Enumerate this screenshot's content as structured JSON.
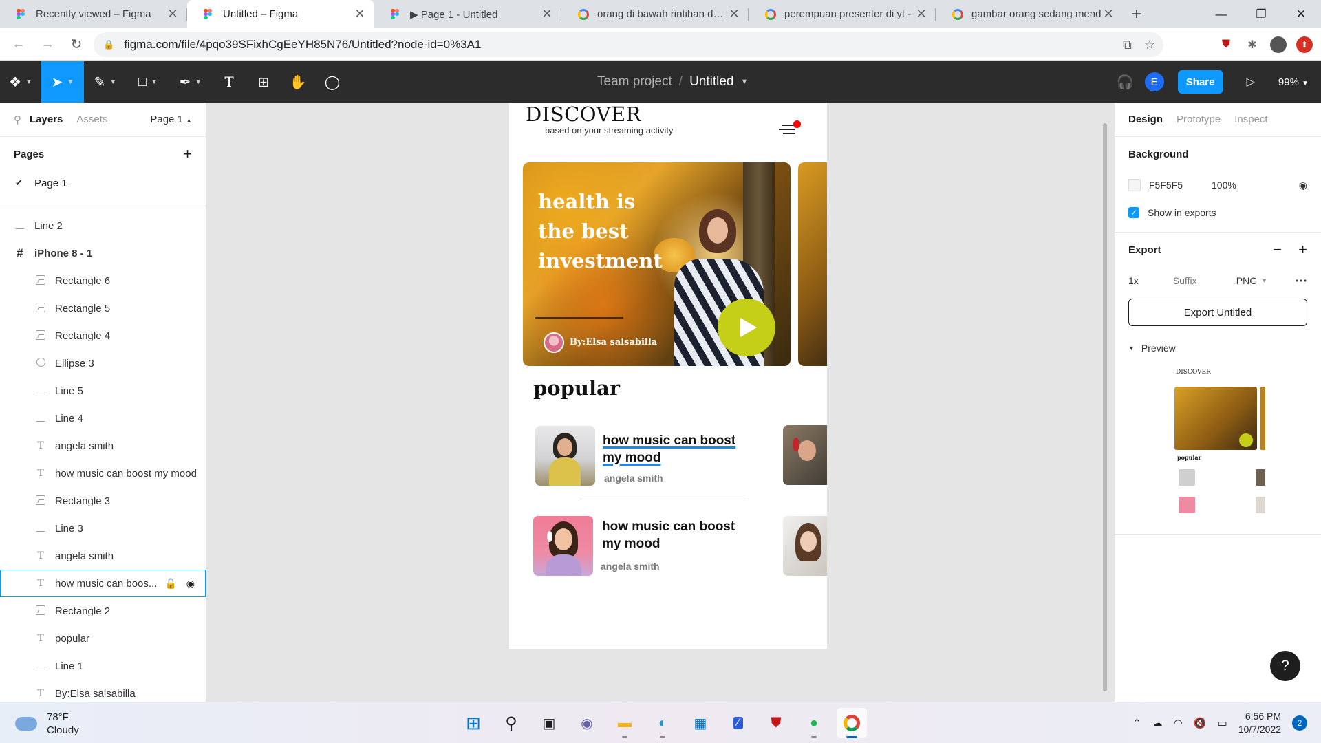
{
  "browser": {
    "tabs": [
      {
        "title": "Recently viewed – Figma",
        "favicon": "figma-icon",
        "active": false
      },
      {
        "title": "Untitled – Figma",
        "favicon": "figma-icon",
        "active": true
      },
      {
        "title": "▶ Page 1 - Untitled",
        "favicon": "figma-icon",
        "active": false
      },
      {
        "title": "orang di bawah rintihan daun",
        "favicon": "google-icon",
        "active": false
      },
      {
        "title": "perempuan presenter di yt -",
        "favicon": "google-icon",
        "active": false
      },
      {
        "title": "gambar orang sedang mend",
        "favicon": "google-icon",
        "active": false
      }
    ],
    "url": "figma.com/file/4pqo39SFixhCgEeYH85N76/Untitled?node-id=0%3A1"
  },
  "figma_toolbar": {
    "team": "Team project",
    "file_name": "Untitled",
    "avatar_initial": "E",
    "share_label": "Share",
    "zoom": "99%"
  },
  "left_panel": {
    "tab_layers": "Layers",
    "tab_assets": "Assets",
    "page_selector": "Page 1",
    "pages_header": "Pages",
    "pages": [
      "Page 1"
    ],
    "layers": [
      {
        "name": "Line 2",
        "type": "line",
        "level": "top"
      },
      {
        "name": "iPhone 8 - 1",
        "type": "frame",
        "level": "top"
      },
      {
        "name": "Rectangle 6",
        "type": "image",
        "level": "child"
      },
      {
        "name": "Rectangle 5",
        "type": "image",
        "level": "child"
      },
      {
        "name": "Rectangle 4",
        "type": "image",
        "level": "child"
      },
      {
        "name": "Ellipse 3",
        "type": "ellipse",
        "level": "child"
      },
      {
        "name": "Line 5",
        "type": "line",
        "level": "child"
      },
      {
        "name": "Line 4",
        "type": "line",
        "level": "child"
      },
      {
        "name": "angela smith",
        "type": "text",
        "level": "child"
      },
      {
        "name": "how music can boost my mood",
        "type": "text",
        "level": "child"
      },
      {
        "name": "Rectangle 3",
        "type": "image",
        "level": "child"
      },
      {
        "name": "Line 3",
        "type": "line",
        "level": "child"
      },
      {
        "name": "angela smith",
        "type": "text",
        "level": "child"
      },
      {
        "name": "how music can boos...",
        "type": "text",
        "level": "child",
        "selected": true
      },
      {
        "name": "Rectangle 2",
        "type": "image",
        "level": "child"
      },
      {
        "name": "popular",
        "type": "text",
        "level": "child"
      },
      {
        "name": "Line 1",
        "type": "line",
        "level": "child"
      },
      {
        "name": "By:Elsa salsabilla",
        "type": "text",
        "level": "child"
      }
    ]
  },
  "design": {
    "title": "DISCOVER",
    "subtitle": "based  on your streaming activity",
    "hero_text": "health is the best investment",
    "hero_author": "By:Elsa salsabilla",
    "popular_label": "popular",
    "cards": [
      {
        "title": "how music can boost my mood",
        "author": "angela smith"
      },
      {
        "title": "how music can boost my mood",
        "author": "angela smith"
      }
    ]
  },
  "right_panel": {
    "tabs": [
      "Design",
      "Prototype",
      "Inspect"
    ],
    "background_label": "Background",
    "bg_color": "F5F5F5",
    "bg_opacity": "100%",
    "show_in_exports": "Show in exports",
    "export_label": "Export",
    "export_scale": "1x",
    "export_suffix_placeholder": "Suffix",
    "export_format": "PNG",
    "export_button": "Export Untitled",
    "preview_label": "Preview",
    "help": "?"
  },
  "taskbar": {
    "temperature": "78°F",
    "condition": "Cloudy",
    "time": "6:56 PM",
    "date": "10/7/2022",
    "notifications": "2"
  },
  "colors": {
    "figma_blue": "#0d99ff",
    "play_button": "#c6cf18",
    "notification_dot": "#ff0000"
  }
}
